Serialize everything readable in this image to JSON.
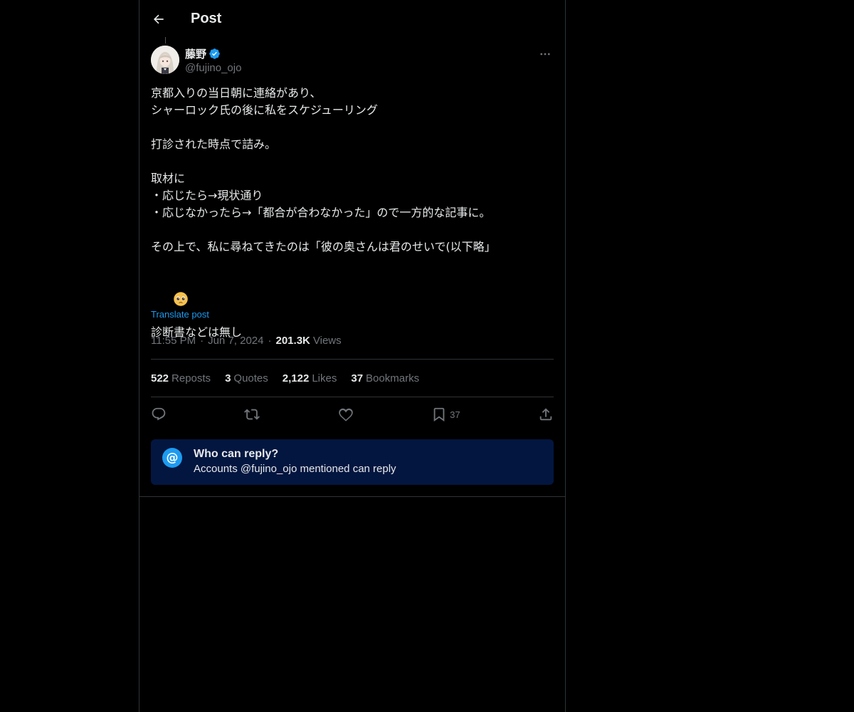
{
  "header": {
    "title": "Post"
  },
  "author": {
    "display_name": "藤野",
    "handle": "@fujino_ojo",
    "verified": true
  },
  "tweet": {
    "lines": [
      "京都入りの当日朝に連絡があり、",
      "シャーロック氏の後に私をスケジューリング",
      "",
      "打診された時点で詰み。",
      "",
      "取材に",
      "・応じたら→現状通り",
      "・応じなかったら→「都合が合わなかった」ので一方的な記事に。",
      "",
      "その上で、私に尋ねてきたのは「彼の奥さんは君のせいで(以下略」",
      ""
    ],
    "emoji_name": "pleading-face-emoji",
    "last_line": "診断書などは無し",
    "translate_label": "Translate post"
  },
  "meta": {
    "time": "11:55 PM",
    "date": "Jun 7, 2024",
    "views_count": "201.3K",
    "views_label": "Views"
  },
  "stats": {
    "reposts_count": "522",
    "reposts_label": "Reposts",
    "quotes_count": "3",
    "quotes_label": "Quotes",
    "likes_count": "2,122",
    "likes_label": "Likes",
    "bookmarks_count": "37",
    "bookmarks_label": "Bookmarks"
  },
  "actions": {
    "reply_icon": "reply-icon",
    "repost_icon": "repost-icon",
    "like_icon": "heart-icon",
    "bookmark_icon": "bookmark-icon",
    "bookmark_count": "37",
    "share_icon": "share-icon"
  },
  "reply_settings": {
    "icon": "@",
    "title": "Who can reply?",
    "subtitle": "Accounts @fujino_ojo mentioned can reply"
  },
  "colors": {
    "background": "#000000",
    "text": "#e7e9ea",
    "muted": "#71767b",
    "accent": "#1d9bf0",
    "border": "#2f3336",
    "reply_box": "#031640"
  }
}
